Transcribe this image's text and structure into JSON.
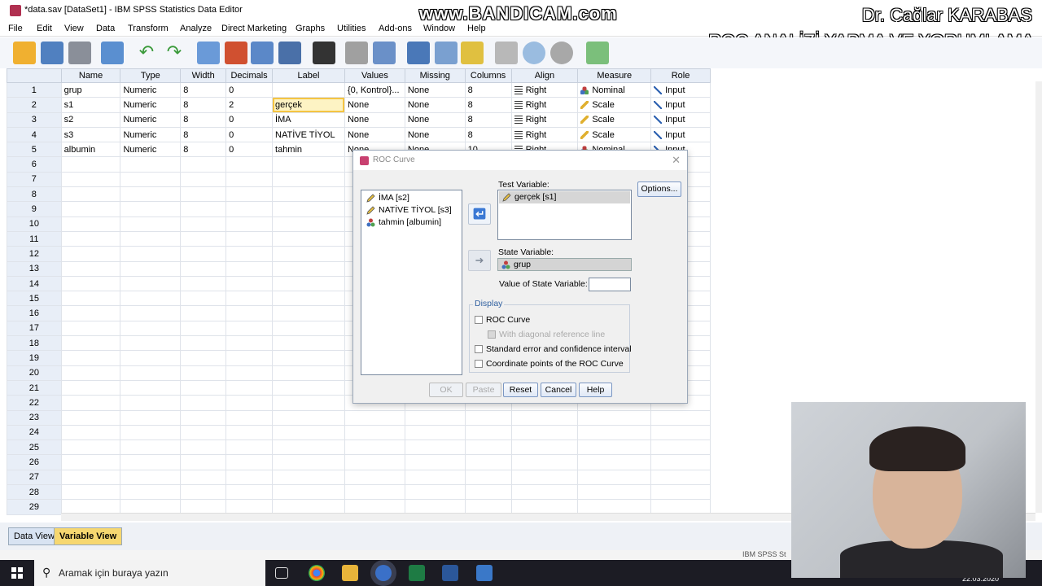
{
  "window": {
    "title": "*data.sav [DataSet1] - IBM SPSS Statistics Data Editor"
  },
  "overlay": {
    "watermark": "www.BANDICAM.com",
    "author": "Dr. Çağlar KARABAŞ",
    "video_title": "ROC ANALİZİ YAPMA VE YORUMLAMA"
  },
  "menu": [
    "File",
    "Edit",
    "View",
    "Data",
    "Transform",
    "Analyze",
    "Direct Marketing",
    "Graphs",
    "Utilities",
    "Add-ons",
    "Window",
    "Help"
  ],
  "grid": {
    "columns": [
      "Name",
      "Type",
      "Width",
      "Decimals",
      "Label",
      "Values",
      "Missing",
      "Columns",
      "Align",
      "Measure",
      "Role"
    ],
    "rows": [
      {
        "num": "1",
        "name": "grup",
        "type": "Numeric",
        "width": "8",
        "decimals": "0",
        "label": "",
        "values": "{0, Kontrol}...",
        "missing": "None",
        "columns": "8",
        "align": "Right",
        "measure": "Nominal",
        "role": "Input"
      },
      {
        "num": "2",
        "name": "s1",
        "type": "Numeric",
        "width": "8",
        "decimals": "2",
        "label": "gerçek",
        "values": "None",
        "missing": "None",
        "columns": "8",
        "align": "Right",
        "measure": "Scale",
        "role": "Input"
      },
      {
        "num": "3",
        "name": "s2",
        "type": "Numeric",
        "width": "8",
        "decimals": "0",
        "label": "İMA",
        "values": "None",
        "missing": "None",
        "columns": "8",
        "align": "Right",
        "measure": "Scale",
        "role": "Input"
      },
      {
        "num": "4",
        "name": "s3",
        "type": "Numeric",
        "width": "8",
        "decimals": "0",
        "label": "NATİVE TİYOL",
        "values": "None",
        "missing": "None",
        "columns": "8",
        "align": "Right",
        "measure": "Scale",
        "role": "Input"
      },
      {
        "num": "5",
        "name": "albumin",
        "type": "Numeric",
        "width": "8",
        "decimals": "0",
        "label": "tahmin",
        "values": "None",
        "missing": "None",
        "columns": "10",
        "align": "Right",
        "measure": "Nominal",
        "role": "Input"
      }
    ],
    "empty_row_numbers": [
      "6",
      "7",
      "8",
      "9",
      "10",
      "11",
      "12",
      "13",
      "14",
      "15",
      "16",
      "17",
      "18",
      "19",
      "20",
      "21",
      "22",
      "23",
      "24",
      "25",
      "26",
      "27",
      "28",
      "29"
    ]
  },
  "tabs": {
    "data_view": "Data View",
    "variable_view": "Variable View"
  },
  "status": {
    "processor": "IBM SPSS St"
  },
  "taskbar": {
    "search_placeholder": "Aramak için buraya yazın",
    "date": "22.03.2020"
  },
  "dialog": {
    "title": "ROC Curve",
    "source_list": [
      "İMA [s2]",
      "NATİVE TİYOL [s3]",
      "tahmin [albumin]"
    ],
    "test_variable_label": "Test Variable:",
    "test_variable_value": "gerçek [s1]",
    "state_variable_label": "State Variable:",
    "state_variable_value": "grup",
    "value_of_state_label": "Value of State Variable:",
    "value_of_state_value": "",
    "options_button": "Options...",
    "display_group": "Display",
    "checkboxes": [
      "ROC Curve",
      "With diagonal reference line",
      "Standard error and confidence interval",
      "Coordinate points of the ROC Curve"
    ],
    "buttons": {
      "ok": "OK",
      "paste": "Paste",
      "reset": "Reset",
      "cancel": "Cancel",
      "help": "Help"
    }
  },
  "colors": {
    "accent": "#3a78d4",
    "selected_cell": "#fdf3c4",
    "header_bg": "#e8eef7"
  }
}
